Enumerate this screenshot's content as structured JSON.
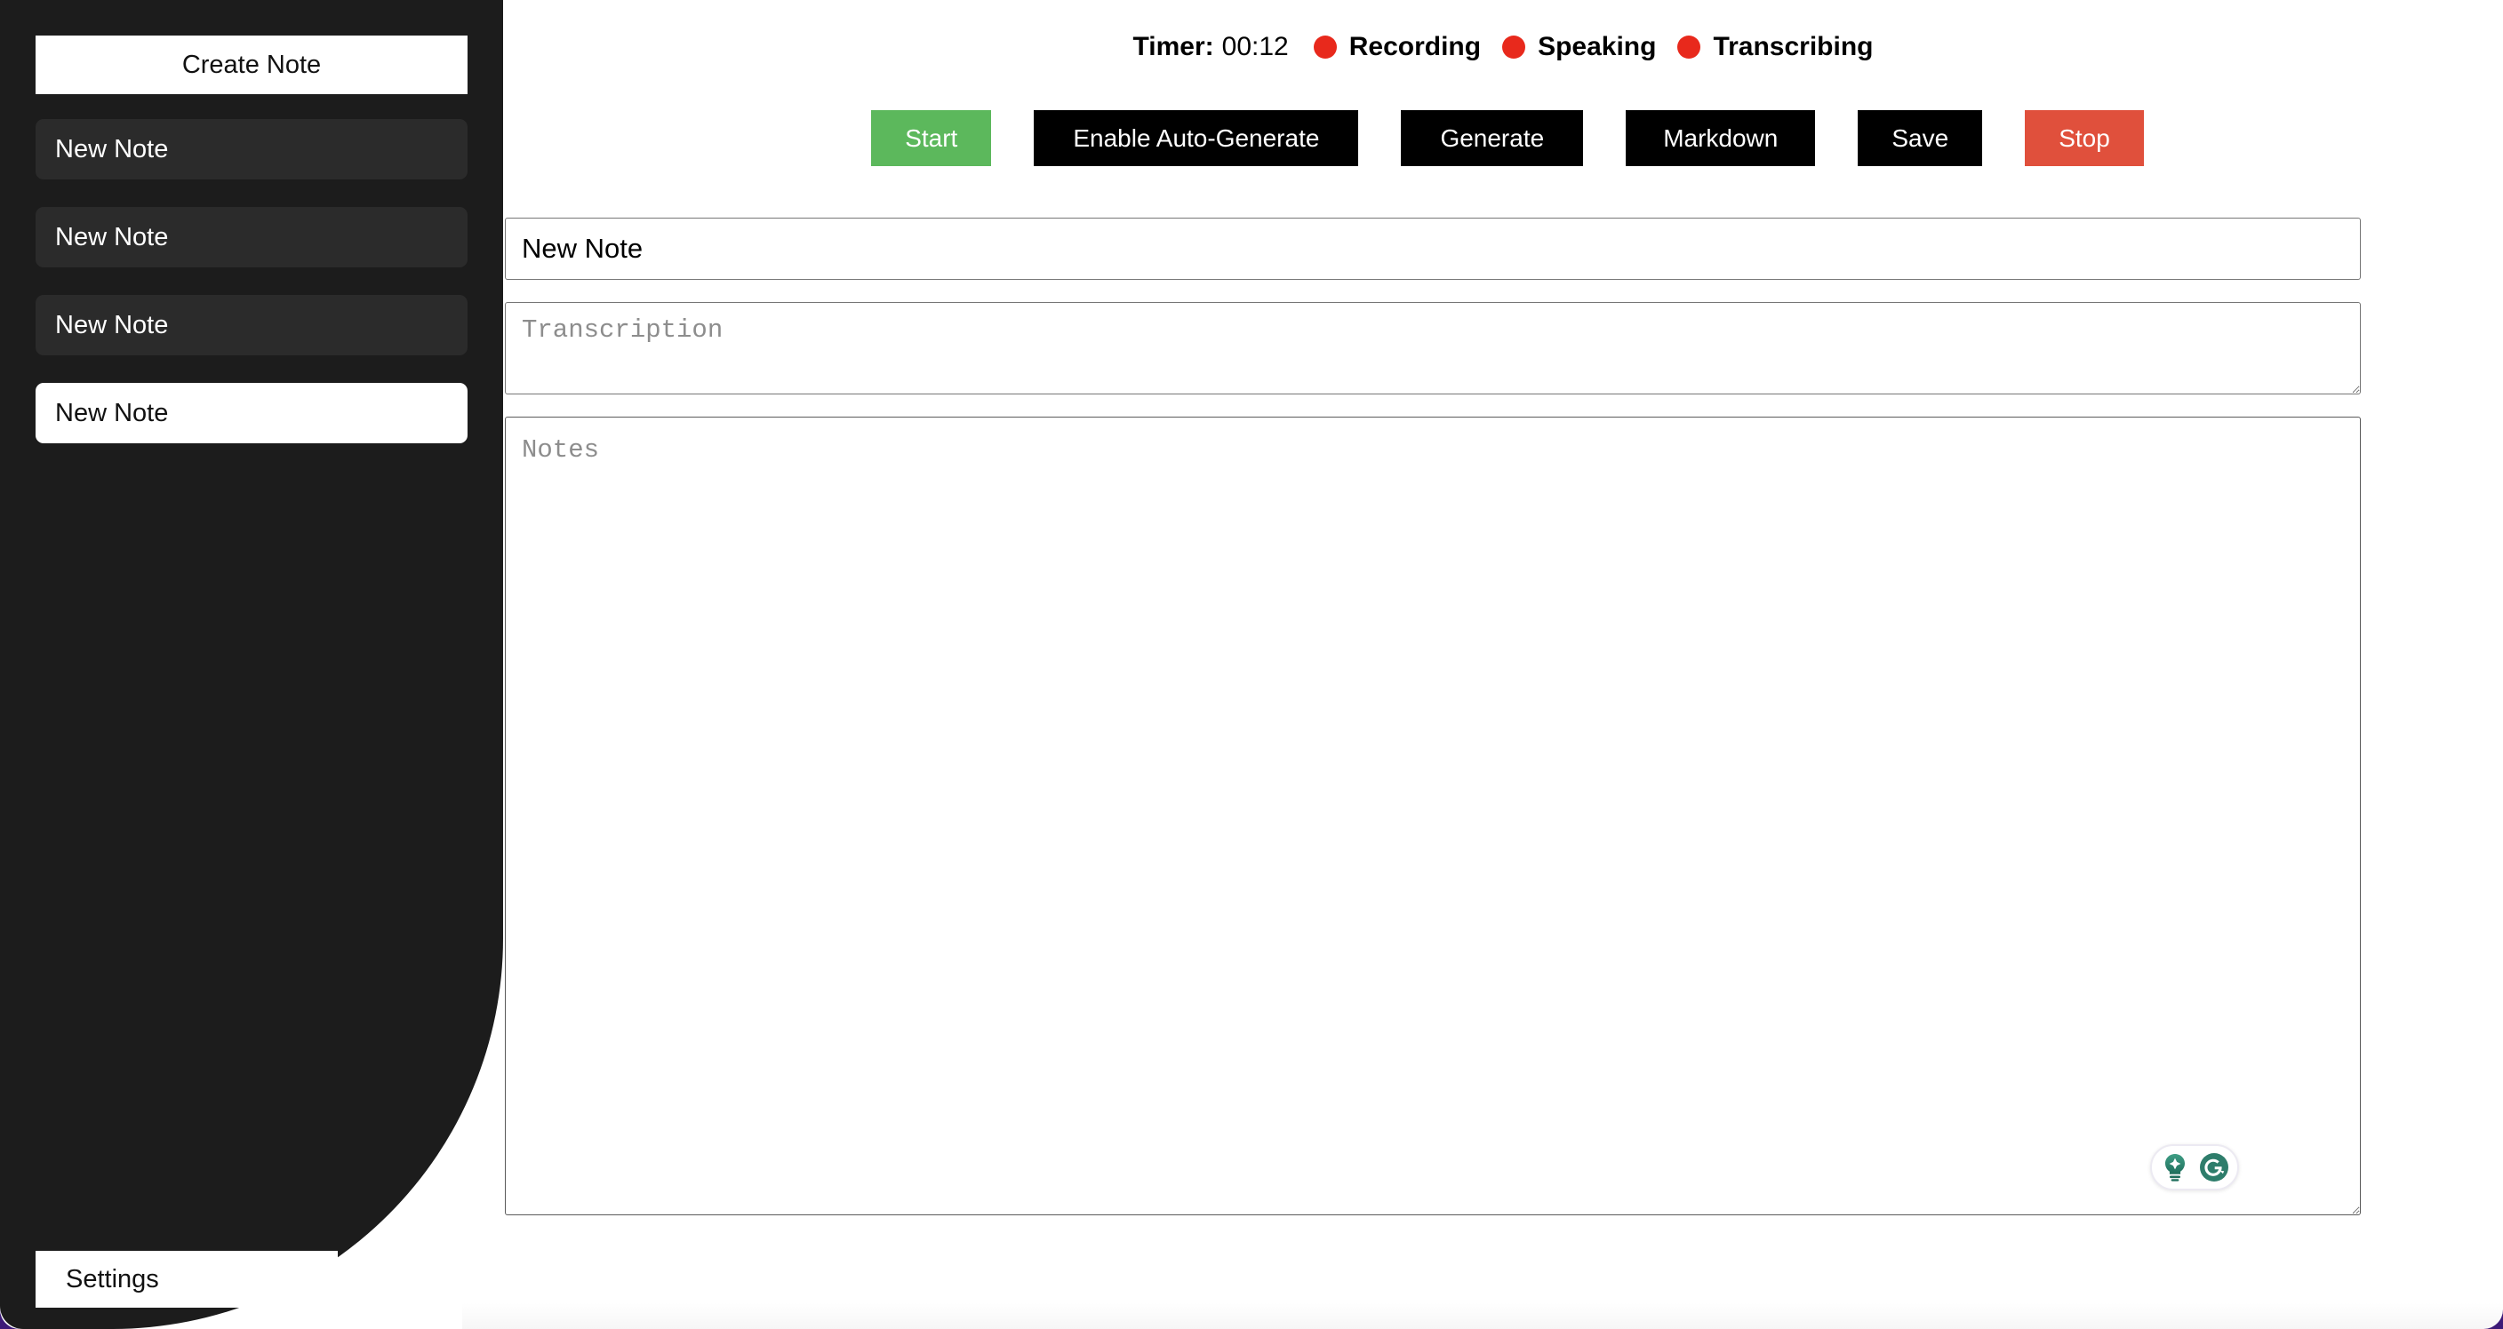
{
  "sidebar": {
    "create_button": "Create Note",
    "notes": [
      {
        "title": "New Note",
        "selected": false
      },
      {
        "title": "New Note",
        "selected": false
      },
      {
        "title": "New Note",
        "selected": false
      },
      {
        "title": "New Note",
        "selected": true
      }
    ],
    "settings_button": "Settings"
  },
  "status": {
    "timer_label": "Timer:",
    "timer_value": "00:12",
    "indicators": [
      {
        "label": "Recording",
        "color": "#e8291c"
      },
      {
        "label": "Speaking",
        "color": "#e8291c"
      },
      {
        "label": "Transcribing",
        "color": "#e8291c"
      }
    ]
  },
  "toolbar": {
    "start": "Start",
    "enable_auto_generate": "Enable Auto-Generate",
    "generate": "Generate",
    "markdown": "Markdown",
    "save": "Save",
    "stop": "Stop",
    "start_color": "#5cb85c",
    "stop_color": "#e0503c",
    "default_color": "#000000"
  },
  "editor": {
    "title_value": "New Note",
    "title_placeholder": "Title",
    "transcription_value": "",
    "transcription_placeholder": "Transcription",
    "notes_value": "",
    "notes_placeholder": "Notes"
  },
  "grammarly": {
    "assistant_icon": "lightbulb-sparkle-icon",
    "logo_icon": "grammarly-g-icon",
    "accent": "#2e7d6b"
  }
}
